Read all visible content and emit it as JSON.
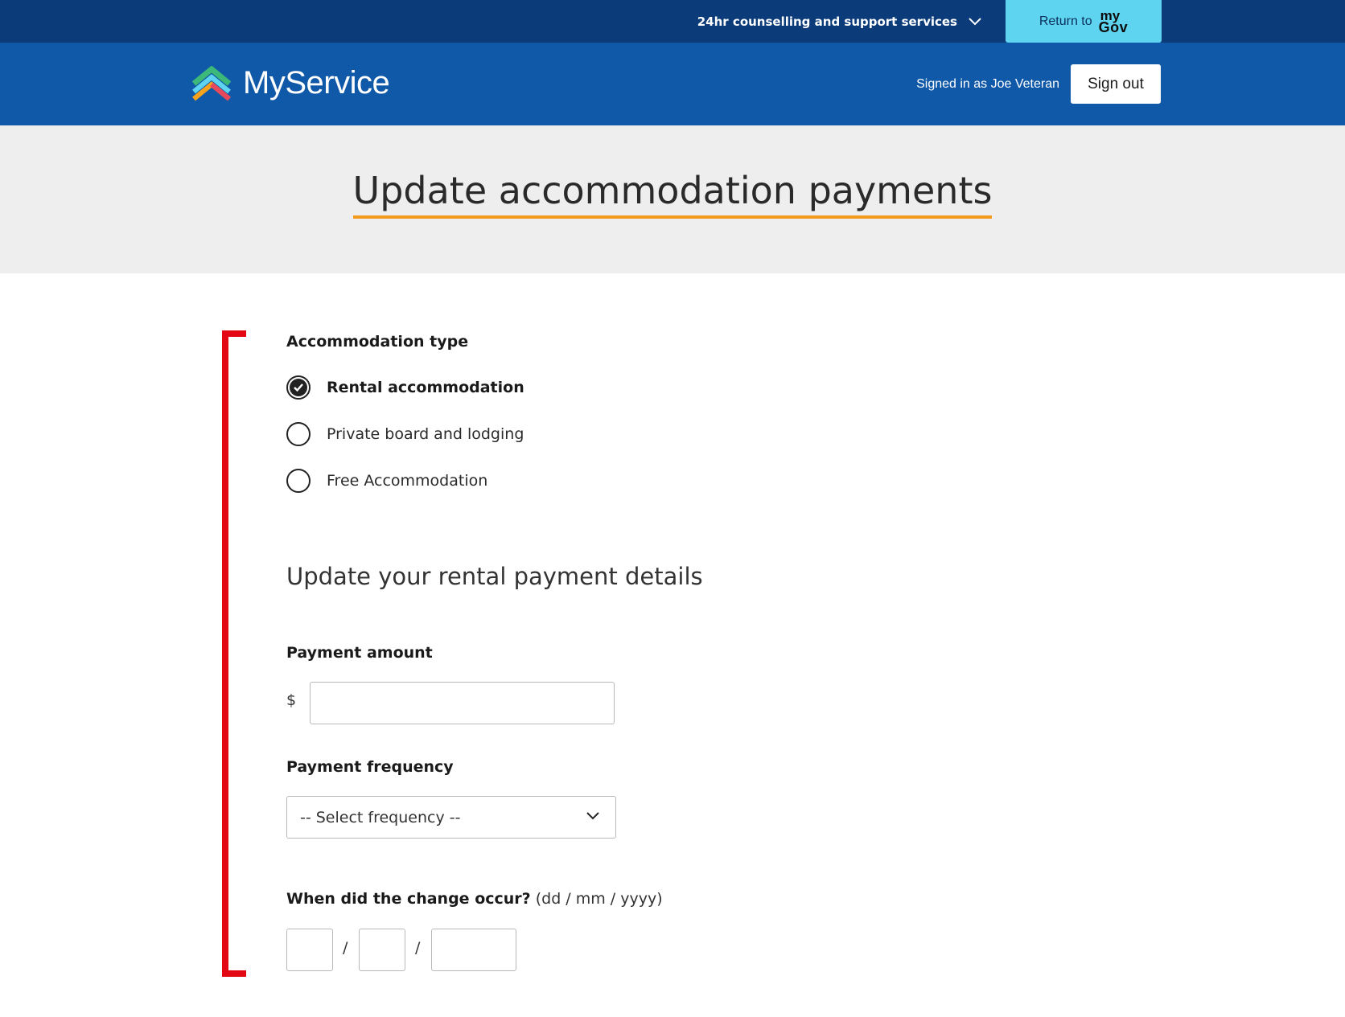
{
  "topbar": {
    "support_label": "24hr counselling and support services",
    "return_label": "Return to",
    "mygov_top": "my",
    "mygov_bottom": "Gov",
    "mygov_color": "#5fd4f0"
  },
  "header": {
    "brand": "MyService",
    "signed_in_text": "Signed in as Joe Veteran",
    "sign_out_label": "Sign out",
    "color": "#1058a8"
  },
  "page": {
    "title": "Update accommodation payments",
    "title_underline_color": "#f39a1e"
  },
  "form": {
    "accommodation_type_label": "Accommodation type",
    "options": [
      {
        "label": "Rental accommodation",
        "checked": true
      },
      {
        "label": "Private board and lodging",
        "checked": false
      },
      {
        "label": "Free Accommodation",
        "checked": false
      }
    ],
    "section_heading": "Update your rental payment details",
    "payment_amount_label": "Payment amount",
    "currency_symbol": "$",
    "payment_amount_value": "",
    "payment_frequency_label": "Payment frequency",
    "payment_frequency_selected": "-- Select frequency --",
    "change_date_label": "When did the change occur?",
    "change_date_hint": "(dd / mm / yyyy)",
    "date_separator": "/",
    "day_value": "",
    "month_value": "",
    "year_value": ""
  },
  "highlight_color": "#e30613"
}
